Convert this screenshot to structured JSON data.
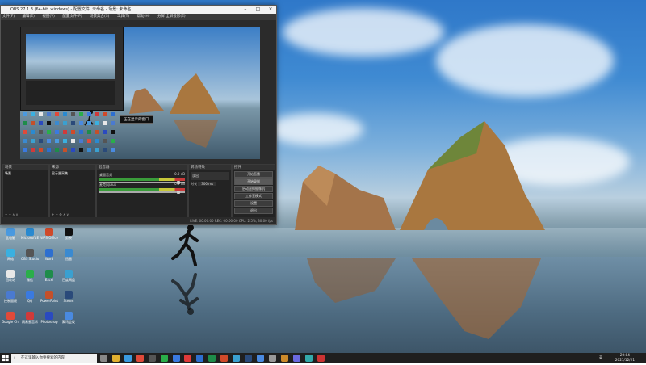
{
  "obs": {
    "title": "OBS 27.1.3 (64-bit, windows) - 配置文件: 未命名 - 场景: 未命名",
    "menu": [
      "文件(F)",
      "编辑(E)",
      "视图(V)",
      "配置文件(P)",
      "场景集合(S)",
      "工具(T)",
      "帮助(H)",
      "分屏 全屏投影(E)"
    ],
    "tooltip": "正在显示的窗口",
    "docks": {
      "scenes": {
        "header": "场景",
        "item": "场景"
      },
      "sources": {
        "header": "来源",
        "item": "显示器采集"
      },
      "mixer": {
        "header": "混音器",
        "tracks": [
          {
            "name": "桌面音频",
            "db": "0.0 dB"
          },
          {
            "name": "麦克风/Aux",
            "db": "0.0 dB"
          }
        ]
      },
      "transitions": {
        "header": "转场特效",
        "fade": "淡出",
        "duration_label": "时长",
        "duration_value": "300 ms"
      },
      "controls": {
        "header": "控件",
        "buttons": [
          "开始直播",
          "开始录制",
          "启动虚拟摄像机",
          "工作室模式",
          "设置",
          "退出"
        ]
      }
    },
    "status": "LIVE: 00:00:00   REC: 00:00:00   CPU: 2.5%, 30.00 fps"
  },
  "desktop": {
    "icons": [
      "此电脑",
      "网络",
      "回收站",
      "控制面板",
      "Google Chrome",
      "Microsoft Edge",
      "OBS Studio",
      "微信",
      "QQ",
      "网易云音乐",
      "WPS Office",
      "Word",
      "Excel",
      "PowerPoint",
      "Photoshop",
      "剪映",
      "迅雷",
      "百度网盘",
      "Steam",
      "腾讯会议"
    ]
  },
  "taskbar": {
    "search_placeholder": "在这里输入你要搜索的内容",
    "time": "20:04",
    "date": "2021/12/21",
    "tray_text": "英"
  },
  "colors": {
    "taskbar_bg": "#1f1f1f",
    "obs_bg": "#2b2b2b",
    "sky": "#3f8ad2"
  }
}
